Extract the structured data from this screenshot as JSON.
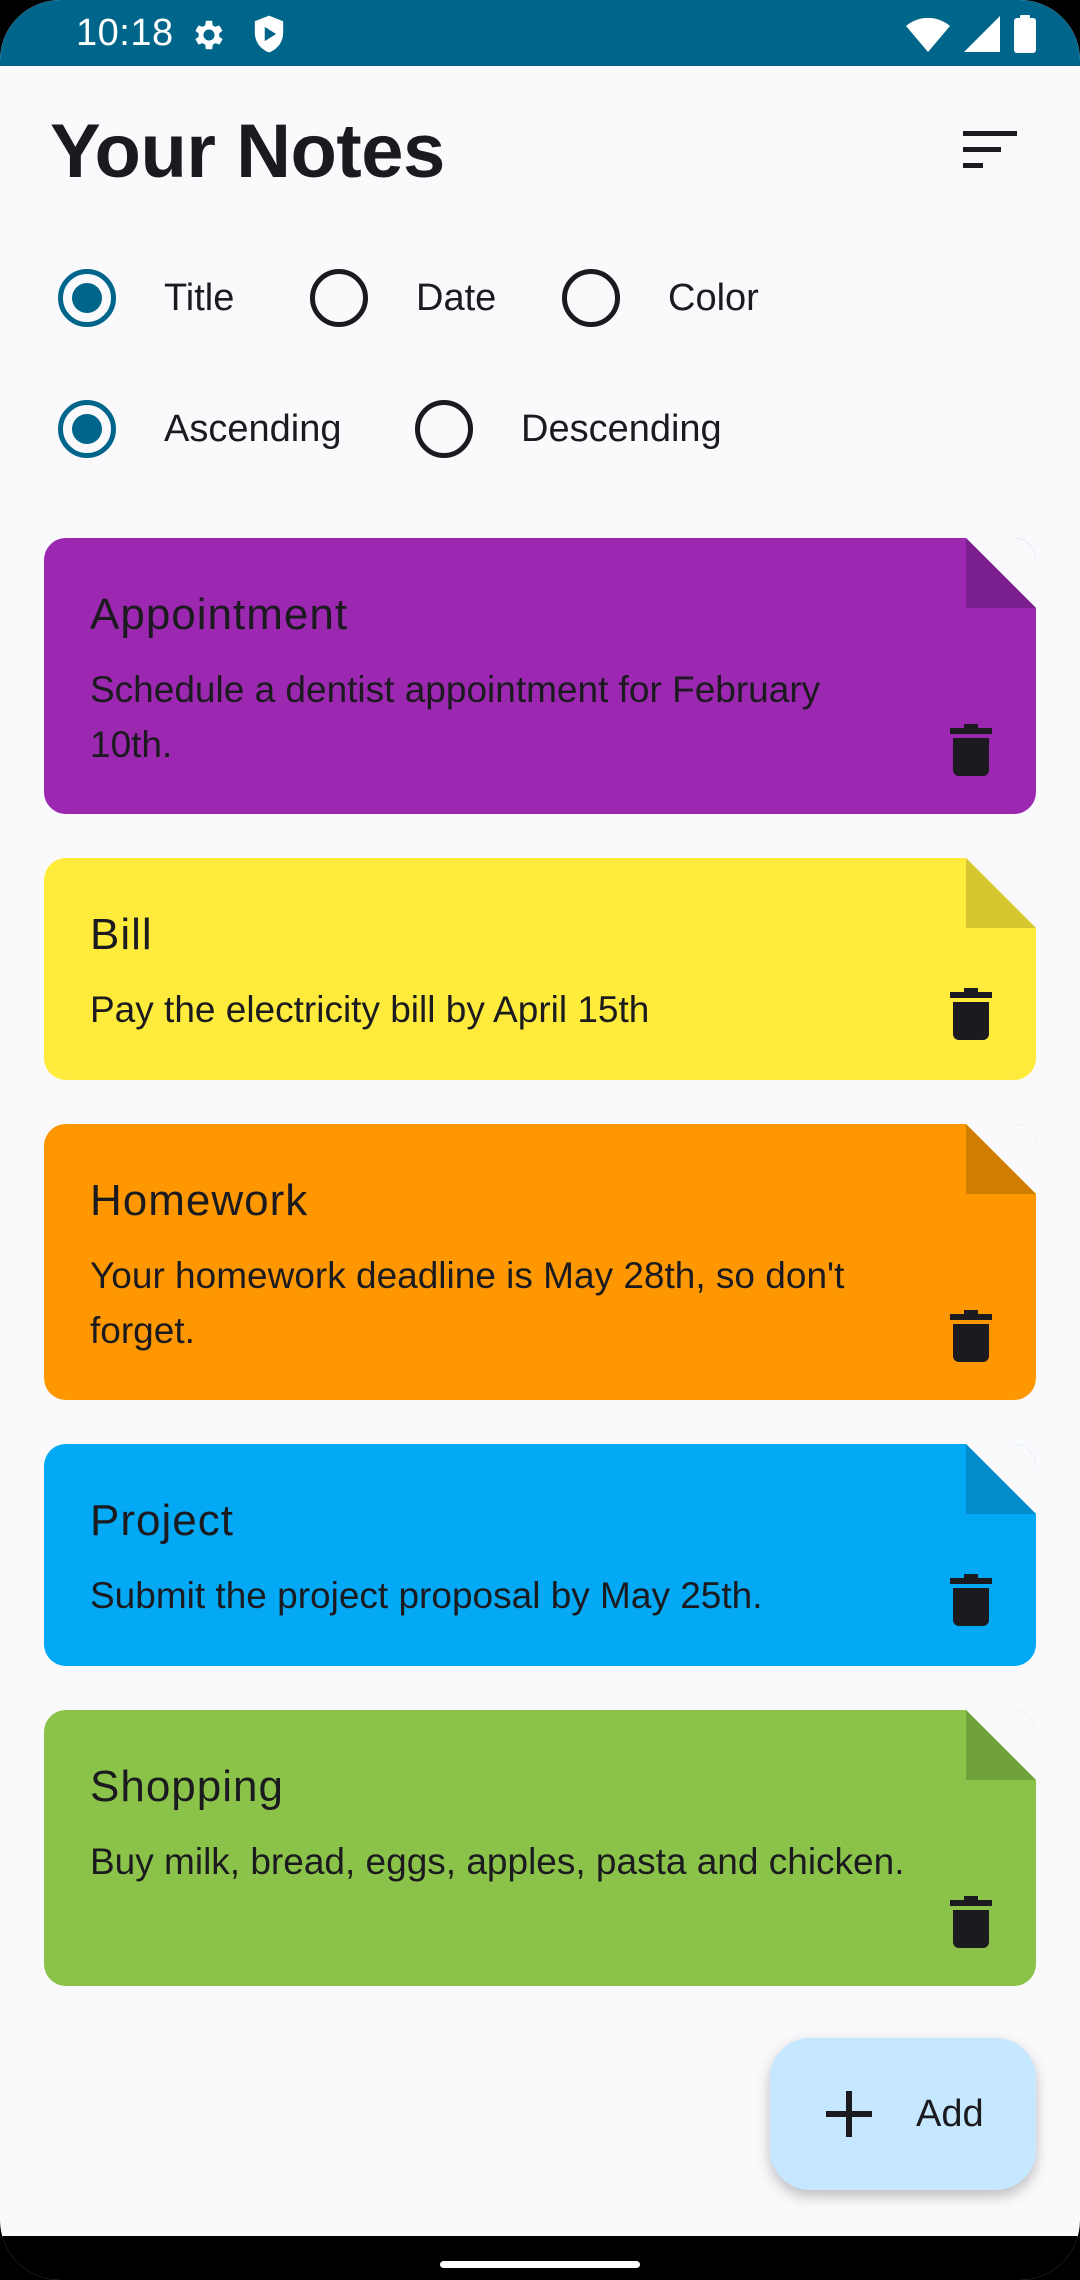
{
  "status_bar": {
    "time": "10:18",
    "icons": [
      "gear-icon",
      "shield-icon",
      "wifi-icon",
      "signal-icon",
      "battery-icon"
    ]
  },
  "header": {
    "title": "Your Notes",
    "sort_icon": "sort-icon"
  },
  "sort_by": {
    "options": [
      {
        "label": "Title",
        "checked": true
      },
      {
        "label": "Date",
        "checked": false
      },
      {
        "label": "Color",
        "checked": false
      }
    ]
  },
  "order": {
    "options": [
      {
        "label": "Ascending",
        "checked": true
      },
      {
        "label": "Descending",
        "checked": false
      }
    ]
  },
  "notes": [
    {
      "title": "Appointment",
      "body": "Schedule a dentist appointment for February 10th.",
      "color": "#9c27b0",
      "fold_color": "#7b1f8e"
    },
    {
      "title": "Bill",
      "body": "Pay the electricity bill by April 15th",
      "color": "#ffeb3b",
      "fold_color": "#d7c52f"
    },
    {
      "title": "Homework",
      "body": "Your homework deadline is May 28th, so don't forget.",
      "color": "#ff9800",
      "fold_color": "#d17d00"
    },
    {
      "title": "Project",
      "body": "Submit the project proposal by May 25th.",
      "color": "#03a9f4",
      "fold_color": "#038ccb"
    },
    {
      "title": "Shopping",
      "body": "Buy milk, bread, eggs, apples, pasta and chicken.",
      "color": "#8bc34a",
      "fold_color": "#71a13b"
    }
  ],
  "fab": {
    "label": "Add",
    "icon": "plus-icon"
  },
  "colors": {
    "accent": "#00658b",
    "background": "#fafafc",
    "fab": "#c5e7ff"
  }
}
